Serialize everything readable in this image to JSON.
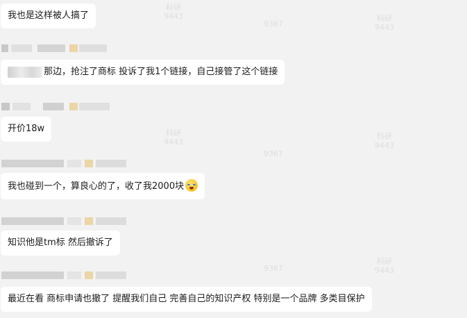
{
  "messages": [
    {
      "text": "我也是这样被人搞了"
    },
    {
      "text": "那边，抢注了商标  投诉了我1个链接，自己接管了这个链接"
    },
    {
      "text": "开价18w"
    },
    {
      "text": "我也碰到一个，算良心的了，收了我2000块",
      "emoji": "laughing-crying-emoji"
    },
    {
      "text": "知识他是tm标  然后撤诉了"
    },
    {
      "text": "最近在看   商标申请也撤了 提醒我们自己 完善自己的知识产权 特别是一个品牌 多类目保护"
    }
  ],
  "watermarks": [
    {
      "line1": "科研",
      "line2": "9443"
    },
    {
      "line1": "9367",
      "line2": ""
    },
    {
      "line1": "科研",
      "line2": "9443"
    },
    {
      "line1": "9367",
      "line2": ""
    },
    {
      "line1": "科研",
      "line2": "9443"
    },
    {
      "line1": "9367",
      "line2": ""
    }
  ],
  "colors": {
    "background": "#f2f2f2",
    "bubble": "#ffffff",
    "text": "#1a1a1a"
  }
}
